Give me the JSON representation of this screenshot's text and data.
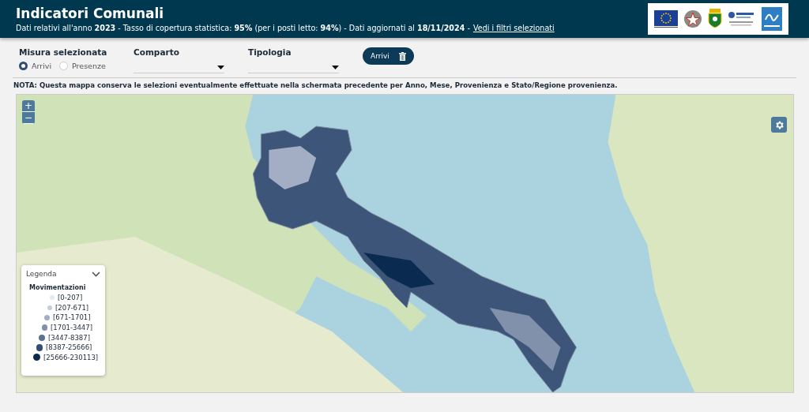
{
  "header": {
    "title": "Indicatori Comunali",
    "subtitle": "Dati relativi all'anno **2023** - Tasso di copertura statistica: **95%** (per i posti letto: **94%**) - Dati aggiornati al **18/11/2024** -",
    "link": "Vedi i filtri selezionati"
  },
  "filters": {
    "measure": {
      "label": "Misura selezionata",
      "options": [
        {
          "label": "Arrivi",
          "selected": true
        },
        {
          "label": "Presenze",
          "selected": false
        }
      ]
    },
    "dropdowns": [
      {
        "label": "Comparto"
      },
      {
        "label": "Tipologia"
      }
    ],
    "chip": {
      "label": "Arrivi"
    }
  },
  "note": "NOTA: Questa mappa conserva le selezioni eventualmente effettuate nella schermata precedente per Anno, Mese, Provenienza e Stato/Regione provenienza.",
  "map": {
    "zoom_in": "+",
    "zoom_out": "−",
    "legend": {
      "title": "Legenda",
      "heading": "Movimentazioni",
      "items": [
        {
          "label": "[0-207]",
          "color": "#e4e9f2"
        },
        {
          "label": "[207-671]",
          "color": "#c4ccdc"
        },
        {
          "label": "[671-1701]",
          "color": "#a3aec4"
        },
        {
          "label": "[1701-3447]",
          "color": "#8291ab"
        },
        {
          "label": "[3447-8387]",
          "color": "#5d7190"
        },
        {
          "label": "[8387-25666]",
          "color": "#334e74"
        },
        {
          "label": "[25666-230113]",
          "color": "#0b2a50"
        }
      ]
    }
  }
}
